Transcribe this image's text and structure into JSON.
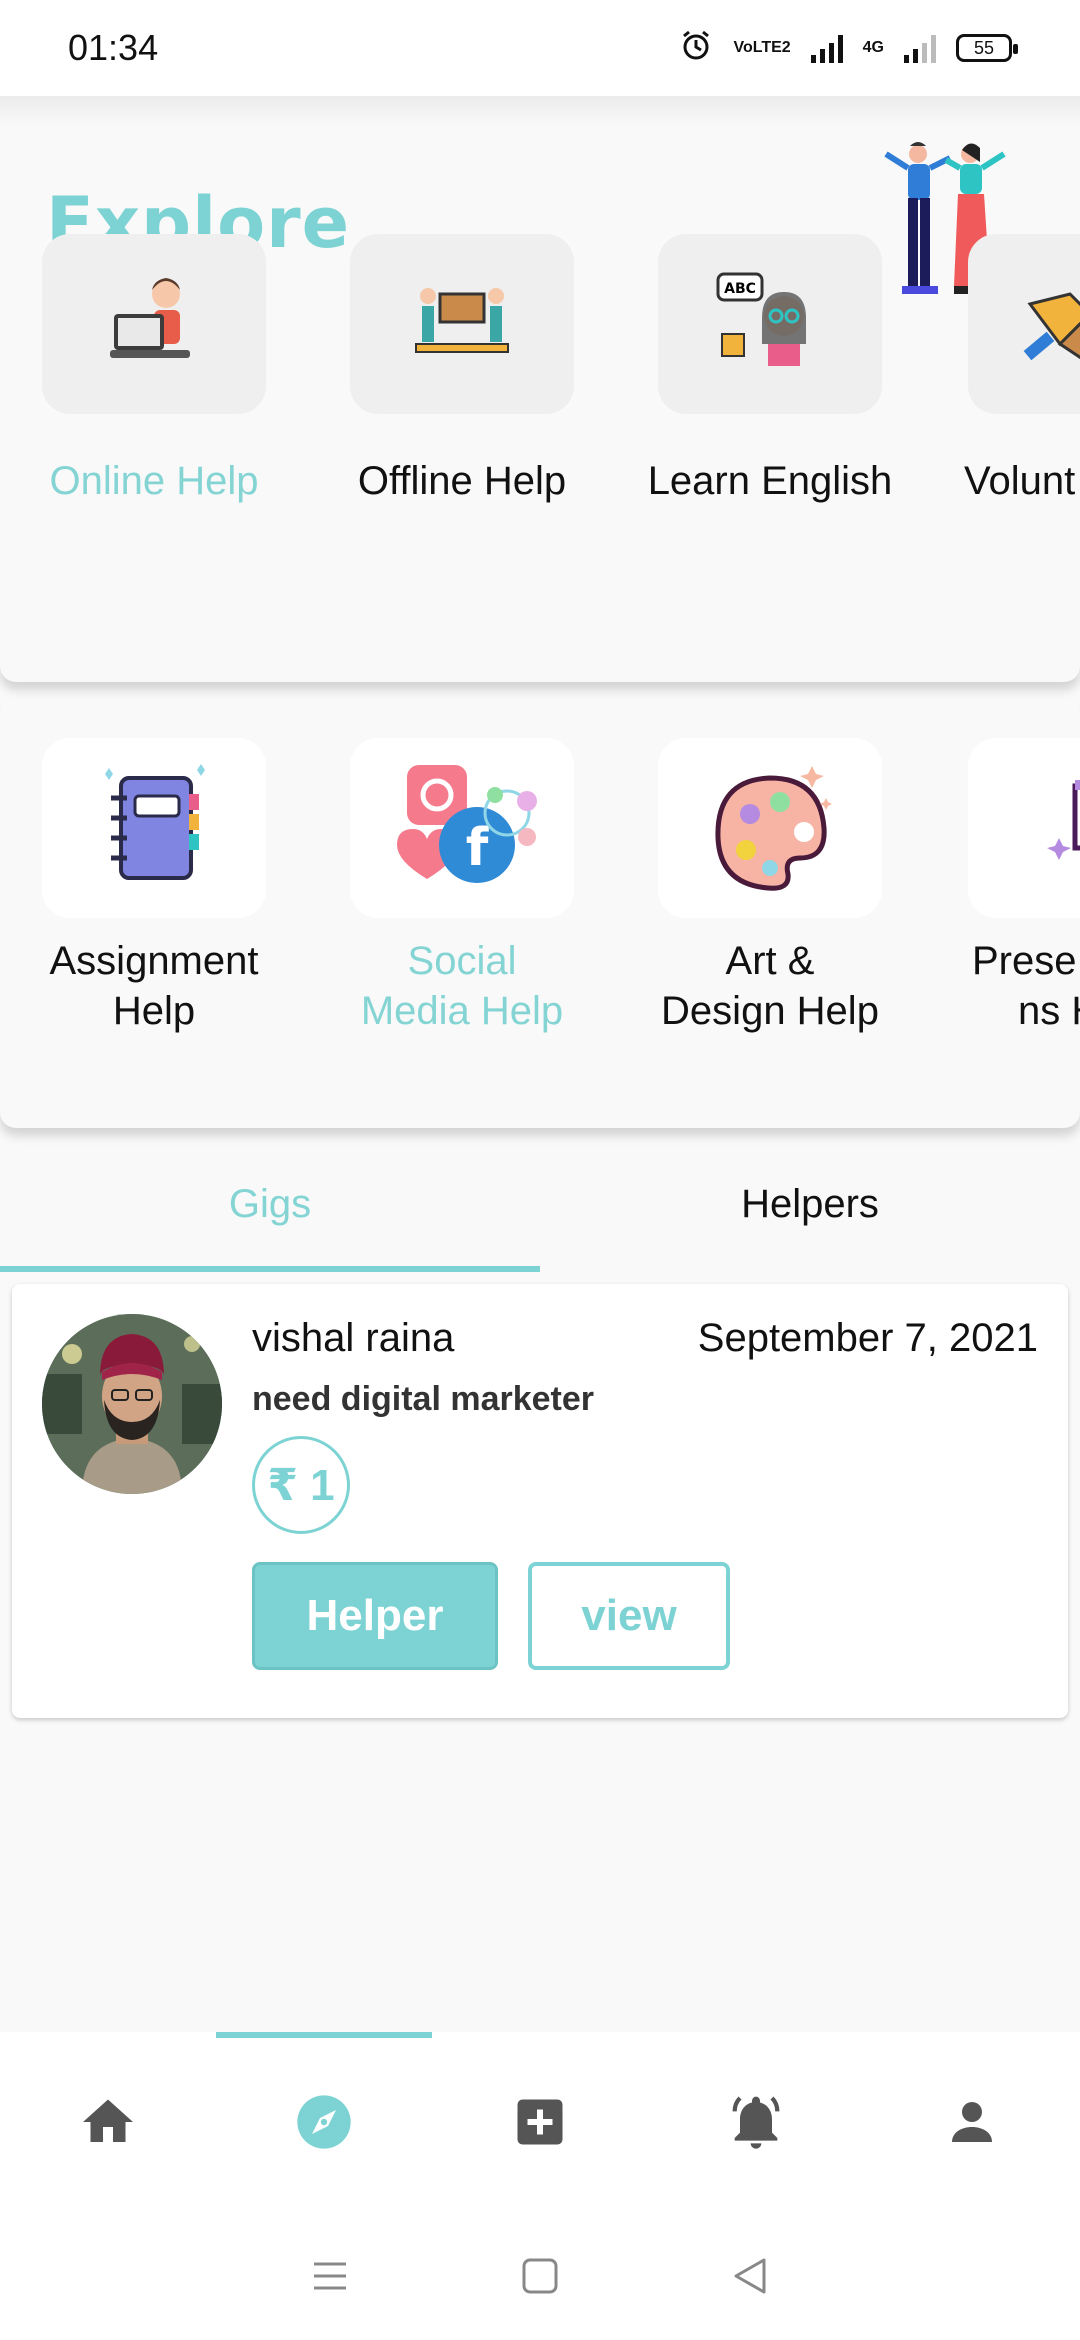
{
  "status_bar": {
    "time": "01:34",
    "battery": "55",
    "network": "4G",
    "carrier_badge": "VoLTE2"
  },
  "explore": {
    "title": "Explore"
  },
  "categories": [
    {
      "label": "Online Help",
      "active": true,
      "icon": "laptop-person-icon"
    },
    {
      "label": "Offline Help",
      "active": false,
      "icon": "people-carry-box-icon"
    },
    {
      "label": "Learn English",
      "active": false,
      "icon": "abc-teacher-icon"
    },
    {
      "label": "Volunt",
      "active": false,
      "icon": "handshake-icon"
    }
  ],
  "help_types": [
    {
      "label_line1": "Assignment",
      "label_line2": "Help",
      "active": false,
      "icon": "notebook-icon"
    },
    {
      "label_line1": "Social",
      "label_line2": "Media Help",
      "active": true,
      "icon": "social-media-icon"
    },
    {
      "label_line1": "Art &",
      "label_line2": "Design Help",
      "active": false,
      "icon": "palette-icon"
    },
    {
      "label_line1": "Prese",
      "label_line2": "ns H",
      "active": false,
      "icon": "presentation-board-icon"
    }
  ],
  "tabs": [
    {
      "label": "Gigs",
      "active": true
    },
    {
      "label": "Helpers",
      "active": false
    }
  ],
  "gig": {
    "name": "vishal raina",
    "date": "September 7, 2021",
    "description": "need digital marketer",
    "price": "₹ 1",
    "primary_button": "Helper",
    "secondary_button": "view"
  },
  "bottom_nav": [
    {
      "icon": "home-icon",
      "active": false
    },
    {
      "icon": "compass-icon",
      "active": true
    },
    {
      "icon": "add-box-icon",
      "active": false
    },
    {
      "icon": "bell-icon",
      "active": false
    },
    {
      "icon": "person-icon",
      "active": false
    }
  ],
  "colors": {
    "accent": "#7dd3d3",
    "text": "#111111"
  }
}
